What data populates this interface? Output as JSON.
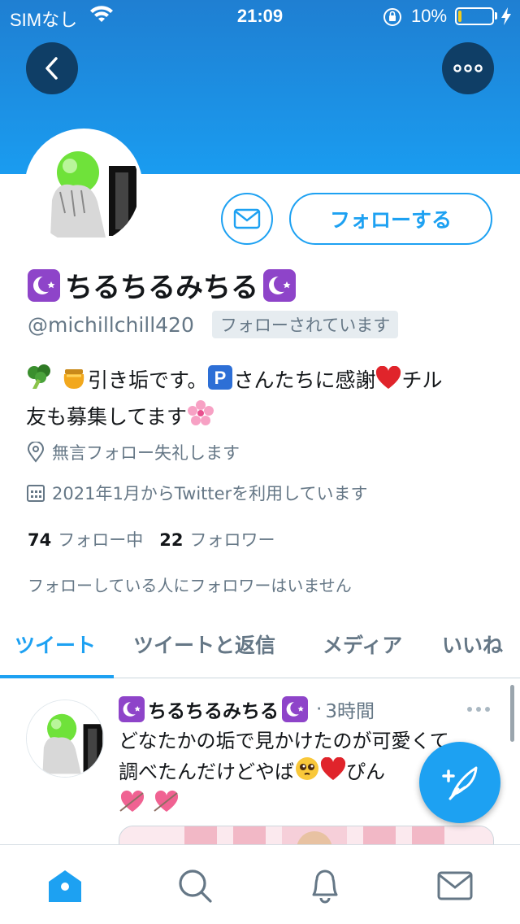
{
  "status_bar": {
    "carrier": "SIMなし",
    "time": "21:09",
    "battery_percent": "10%",
    "battery_level": 0.1
  },
  "profile": {
    "display_name": "ちるちるみちる",
    "handle": "@michillchill420",
    "follows_you_badge": "フォローされています",
    "follow_button": "フォローする",
    "bio_line1_text_a": "引き垢です。",
    "bio_line1_text_b": "さんたちに感謝",
    "bio_line1_text_c": "チル",
    "bio_line2_text": "友も募集してます",
    "parking_badge": "P",
    "location": "無言フォロー失礼します",
    "joined": "2021年1月からTwitterを利用しています",
    "following_count": "74",
    "following_label": "フォロー中",
    "followers_count": "22",
    "followers_label": "フォロワー",
    "followers_note": "フォローしている人にフォロワーはいません"
  },
  "tabs": [
    {
      "label": "ツイート",
      "active": true
    },
    {
      "label": "ツイートと返信",
      "active": false
    },
    {
      "label": "メディア",
      "active": false
    },
    {
      "label": "いいね",
      "active": false
    }
  ],
  "tweet": {
    "author": "ちるちるみちる",
    "separator": "·",
    "time": "3時間",
    "line1": "どなたかの垢で見かけたのが可愛くて",
    "line2": "調べたんだけどやば",
    "line2_tail": "ぴん"
  },
  "icons": {
    "back": "chevron-left-icon",
    "more": "more-icon",
    "message": "envelope-icon",
    "location": "location-pin-icon",
    "calendar": "calendar-icon",
    "compose": "compose-tweet-icon",
    "home": "home-icon",
    "search": "search-icon",
    "notifications": "bell-icon",
    "messages": "mail-icon"
  },
  "colors": {
    "accent": "#1da1f2",
    "banner": "#1a9cf0",
    "moon_badge": "#8e44c9"
  }
}
